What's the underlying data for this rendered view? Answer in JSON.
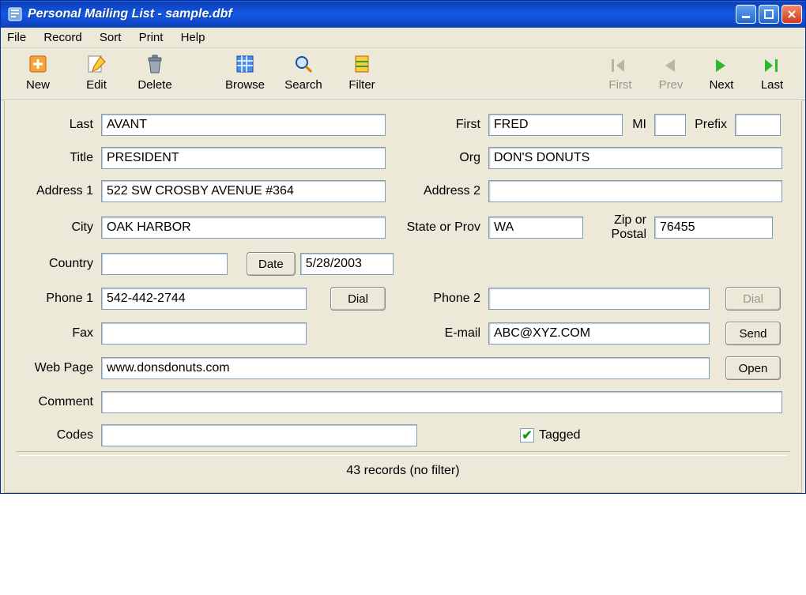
{
  "window": {
    "title": "Personal Mailing List - sample.dbf"
  },
  "menu": {
    "file": "File",
    "record": "Record",
    "sort": "Sort",
    "print": "Print",
    "help": "Help"
  },
  "toolbar": {
    "new": "New",
    "edit": "Edit",
    "delete": "Delete",
    "browse": "Browse",
    "search": "Search",
    "filter": "Filter",
    "first": "First",
    "prev": "Prev",
    "next": "Next",
    "last": "Last"
  },
  "labels": {
    "last": "Last",
    "first": "First",
    "mi": "MI",
    "prefix": "Prefix",
    "title": "Title",
    "org": "Org",
    "address1": "Address 1",
    "address2": "Address 2",
    "city": "City",
    "state": "State or Prov",
    "zip": "Zip or Postal",
    "country": "Country",
    "date_btn": "Date",
    "phone1": "Phone 1",
    "dial": "Dial",
    "phone2": "Phone 2",
    "fax": "Fax",
    "email": "E-mail",
    "send": "Send",
    "webpage": "Web Page",
    "open": "Open",
    "comment": "Comment",
    "codes": "Codes",
    "tagged": "Tagged"
  },
  "fields": {
    "last": "AVANT",
    "first": "FRED",
    "mi": "",
    "prefix": "",
    "title": "PRESIDENT",
    "org": "DON'S DONUTS",
    "address1": "522 SW CROSBY AVENUE #364",
    "address2": "",
    "city": "OAK HARBOR",
    "state": "WA",
    "zip": "76455",
    "country": "",
    "date": "5/28/2003",
    "phone1": "542-442-2744",
    "phone2": "",
    "fax": "",
    "email": "ABC@XYZ.COM",
    "webpage": "www.donsdonuts.com",
    "comment": "",
    "codes": "",
    "tagged": true
  },
  "status": {
    "text": "43 records (no filter)"
  }
}
